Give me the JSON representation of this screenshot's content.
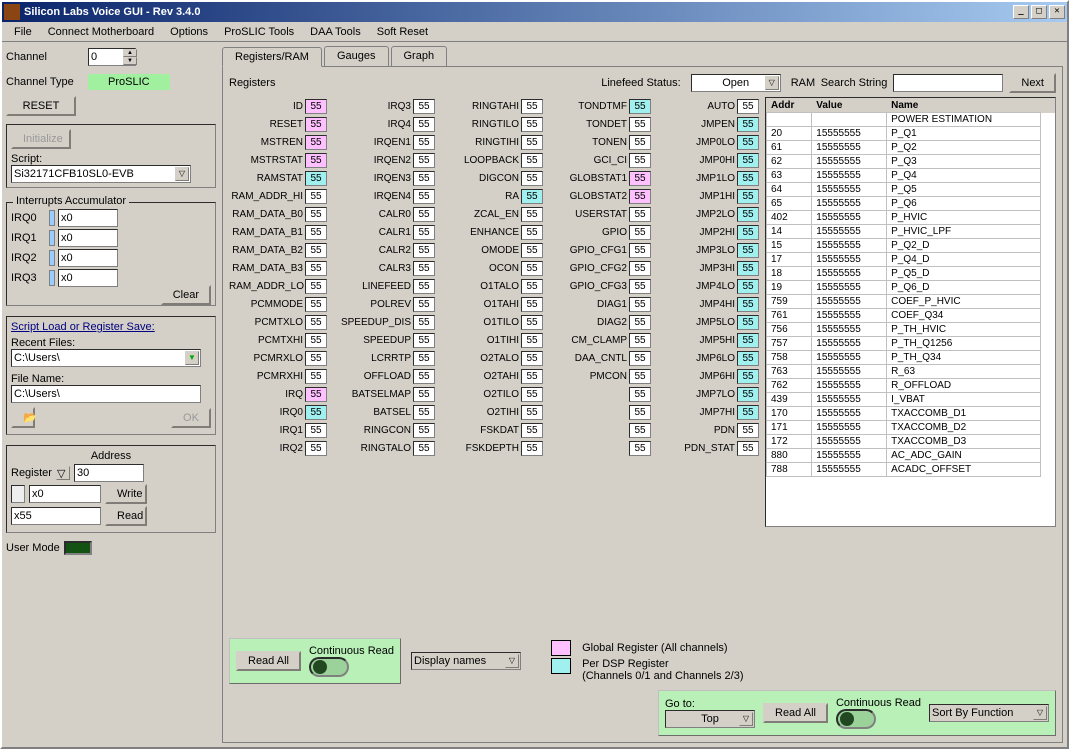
{
  "title": "Silicon Labs Voice GUI - Rev 3.4.0",
  "menu": [
    "File",
    "Connect Motherboard",
    "Options",
    "ProSLIC Tools",
    "DAA Tools",
    "Soft Reset"
  ],
  "left": {
    "channel_lbl": "Channel",
    "channel_val": "0",
    "chtype_lbl": "Channel Type",
    "chtype_val": "ProSLIC",
    "reset": "RESET",
    "init": "Initialize",
    "script_lbl": "Script:",
    "script_val": "Si32171CFB10SL0-EVB",
    "int_title": "Interrupts Accumulator",
    "irqs": [
      {
        "lbl": "IRQ0",
        "val": "x0"
      },
      {
        "lbl": "IRQ1",
        "val": "x0"
      },
      {
        "lbl": "IRQ2",
        "val": "x0"
      },
      {
        "lbl": "IRQ3",
        "val": "x0"
      }
    ],
    "clear": "Clear",
    "sls_title": "Script Load or Register Save:",
    "recent_lbl": "Recent Files:",
    "recent_val": "C:\\Users\\",
    "fname_lbl": "File Name:",
    "fname_val": "C:\\Users\\",
    "ok": "OK",
    "addr_title": "Address",
    "reg_lbl": "Register",
    "reg_val": "30",
    "write_val": "x0",
    "write": "Write",
    "read_val": "x55",
    "read": "Read",
    "usermode": "User Mode"
  },
  "tabs": [
    "Registers/RAM",
    "Gauges",
    "Graph"
  ],
  "reg_hdr": "Registers",
  "linefeed_lbl": "Linefeed Status:",
  "linefeed_val": "Open",
  "ram_lbl": "RAM",
  "search_lbl": "Search String",
  "next": "Next",
  "registers": [
    [
      {
        "n": "ID",
        "v": "55",
        "c": "pink"
      },
      {
        "n": "RESET",
        "v": "55",
        "c": "pink"
      },
      {
        "n": "MSTREN",
        "v": "55",
        "c": "pink"
      },
      {
        "n": "MSTRSTAT",
        "v": "55",
        "c": "pink"
      },
      {
        "n": "RAMSTAT",
        "v": "55",
        "c": "cyan"
      },
      {
        "n": "RAM_ADDR_HI",
        "v": "55"
      },
      {
        "n": "RAM_DATA_B0",
        "v": "55"
      },
      {
        "n": "RAM_DATA_B1",
        "v": "55"
      },
      {
        "n": "RAM_DATA_B2",
        "v": "55"
      },
      {
        "n": "RAM_DATA_B3",
        "v": "55"
      },
      {
        "n": "RAM_ADDR_LO",
        "v": "55"
      },
      {
        "n": "PCMMODE",
        "v": "55"
      },
      {
        "n": "PCMTXLO",
        "v": "55"
      },
      {
        "n": "PCMTXHI",
        "v": "55"
      },
      {
        "n": "PCMRXLO",
        "v": "55"
      },
      {
        "n": "PCMRXHI",
        "v": "55"
      },
      {
        "n": "IRQ",
        "v": "55",
        "c": "pink"
      },
      {
        "n": "IRQ0",
        "v": "55",
        "c": "cyan"
      },
      {
        "n": "IRQ1",
        "v": "55"
      },
      {
        "n": "IRQ2",
        "v": "55"
      }
    ],
    [
      {
        "n": "IRQ3",
        "v": "55"
      },
      {
        "n": "IRQ4",
        "v": "55"
      },
      {
        "n": "IRQEN1",
        "v": "55"
      },
      {
        "n": "IRQEN2",
        "v": "55"
      },
      {
        "n": "IRQEN3",
        "v": "55"
      },
      {
        "n": "IRQEN4",
        "v": "55"
      },
      {
        "n": "CALR0",
        "v": "55"
      },
      {
        "n": "CALR1",
        "v": "55"
      },
      {
        "n": "CALR2",
        "v": "55"
      },
      {
        "n": "CALR3",
        "v": "55"
      },
      {
        "n": "LINEFEED",
        "v": "55"
      },
      {
        "n": "POLREV",
        "v": "55"
      },
      {
        "n": "SPEEDUP_DIS",
        "v": "55"
      },
      {
        "n": "SPEEDUP",
        "v": "55"
      },
      {
        "n": "LCRRTP",
        "v": "55"
      },
      {
        "n": "OFFLOAD",
        "v": "55"
      },
      {
        "n": "BATSELMAP",
        "v": "55"
      },
      {
        "n": "BATSEL",
        "v": "55"
      },
      {
        "n": "RINGCON",
        "v": "55"
      },
      {
        "n": "RINGTALO",
        "v": "55"
      }
    ],
    [
      {
        "n": "RINGTAHI",
        "v": "55"
      },
      {
        "n": "RINGTILO",
        "v": "55"
      },
      {
        "n": "RINGTIHI",
        "v": "55"
      },
      {
        "n": "LOOPBACK",
        "v": "55"
      },
      {
        "n": "DIGCON",
        "v": "55"
      },
      {
        "n": "RA",
        "v": "55",
        "c": "cyan"
      },
      {
        "n": "ZCAL_EN",
        "v": "55"
      },
      {
        "n": "ENHANCE",
        "v": "55"
      },
      {
        "n": "OMODE",
        "v": "55"
      },
      {
        "n": "OCON",
        "v": "55"
      },
      {
        "n": "O1TALO",
        "v": "55"
      },
      {
        "n": "O1TAHI",
        "v": "55"
      },
      {
        "n": "O1TILO",
        "v": "55"
      },
      {
        "n": "O1TIHI",
        "v": "55"
      },
      {
        "n": "O2TALO",
        "v": "55"
      },
      {
        "n": "O2TAHI",
        "v": "55"
      },
      {
        "n": "O2TILO",
        "v": "55"
      },
      {
        "n": "O2TIHI",
        "v": "55"
      },
      {
        "n": "FSKDAT",
        "v": "55"
      },
      {
        "n": "FSKDEPTH",
        "v": "55"
      }
    ],
    [
      {
        "n": "TONDTMF",
        "v": "55",
        "c": "cyan"
      },
      {
        "n": "TONDET",
        "v": "55"
      },
      {
        "n": "TONEN",
        "v": "55"
      },
      {
        "n": "GCI_CI",
        "v": "55"
      },
      {
        "n": "GLOBSTAT1",
        "v": "55",
        "c": "pink"
      },
      {
        "n": "GLOBSTAT2",
        "v": "55",
        "c": "pink"
      },
      {
        "n": "USERSTAT",
        "v": "55"
      },
      {
        "n": "GPIO",
        "v": "55"
      },
      {
        "n": "GPIO_CFG1",
        "v": "55"
      },
      {
        "n": "GPIO_CFG2",
        "v": "55"
      },
      {
        "n": "GPIO_CFG3",
        "v": "55"
      },
      {
        "n": "DIAG1",
        "v": "55"
      },
      {
        "n": "DIAG2",
        "v": "55"
      },
      {
        "n": "CM_CLAMP",
        "v": "55"
      },
      {
        "n": "DAA_CNTL",
        "v": "55"
      },
      {
        "n": "PMCON",
        "v": "55"
      },
      {
        "n": "",
        "v": "55"
      },
      {
        "n": "",
        "v": "55"
      },
      {
        "n": "",
        "v": "55"
      },
      {
        "n": "",
        "v": "55"
      }
    ],
    [
      {
        "n": "AUTO",
        "v": "55"
      },
      {
        "n": "JMPEN",
        "v": "55",
        "c": "cyan"
      },
      {
        "n": "JMP0LO",
        "v": "55",
        "c": "cyan"
      },
      {
        "n": "JMP0HI",
        "v": "55",
        "c": "cyan"
      },
      {
        "n": "JMP1LO",
        "v": "55",
        "c": "cyan"
      },
      {
        "n": "JMP1HI",
        "v": "55",
        "c": "cyan"
      },
      {
        "n": "JMP2LO",
        "v": "55",
        "c": "cyan"
      },
      {
        "n": "JMP2HI",
        "v": "55",
        "c": "cyan"
      },
      {
        "n": "JMP3LO",
        "v": "55",
        "c": "cyan"
      },
      {
        "n": "JMP3HI",
        "v": "55",
        "c": "cyan"
      },
      {
        "n": "JMP4LO",
        "v": "55",
        "c": "cyan"
      },
      {
        "n": "JMP4HI",
        "v": "55",
        "c": "cyan"
      },
      {
        "n": "JMP5LO",
        "v": "55",
        "c": "cyan"
      },
      {
        "n": "JMP5HI",
        "v": "55",
        "c": "cyan"
      },
      {
        "n": "JMP6LO",
        "v": "55",
        "c": "cyan"
      },
      {
        "n": "JMP6HI",
        "v": "55",
        "c": "cyan"
      },
      {
        "n": "JMP7LO",
        "v": "55",
        "c": "cyan"
      },
      {
        "n": "JMP7HI",
        "v": "55",
        "c": "cyan"
      },
      {
        "n": "PDN",
        "v": "55"
      },
      {
        "n": "PDN_STAT",
        "v": "55"
      }
    ]
  ],
  "ram_cols": [
    "Addr",
    "Value",
    "Name"
  ],
  "ram_rows": [
    {
      "a": "",
      "v": "",
      "n": "POWER ESTIMATION"
    },
    {
      "a": "20",
      "v": "15555555",
      "n": "P_Q1"
    },
    {
      "a": "61",
      "v": "15555555",
      "n": "P_Q2"
    },
    {
      "a": "62",
      "v": "15555555",
      "n": "P_Q3"
    },
    {
      "a": "63",
      "v": "15555555",
      "n": "P_Q4"
    },
    {
      "a": "64",
      "v": "15555555",
      "n": "P_Q5"
    },
    {
      "a": "65",
      "v": "15555555",
      "n": "P_Q6"
    },
    {
      "a": "402",
      "v": "15555555",
      "n": "P_HVIC"
    },
    {
      "a": "14",
      "v": "15555555",
      "n": "P_HVIC_LPF"
    },
    {
      "a": "15",
      "v": "15555555",
      "n": "P_Q2_D"
    },
    {
      "a": "17",
      "v": "15555555",
      "n": "P_Q4_D"
    },
    {
      "a": "18",
      "v": "15555555",
      "n": "P_Q5_D"
    },
    {
      "a": "19",
      "v": "15555555",
      "n": "P_Q6_D"
    },
    {
      "a": "759",
      "v": "15555555",
      "n": "COEF_P_HVIC"
    },
    {
      "a": "761",
      "v": "15555555",
      "n": "COEF_Q34"
    },
    {
      "a": "756",
      "v": "15555555",
      "n": "P_TH_HVIC"
    },
    {
      "a": "757",
      "v": "15555555",
      "n": "P_TH_Q1256"
    },
    {
      "a": "758",
      "v": "15555555",
      "n": "P_TH_Q34"
    },
    {
      "a": "763",
      "v": "15555555",
      "n": "R_63"
    },
    {
      "a": "762",
      "v": "15555555",
      "n": "R_OFFLOAD"
    },
    {
      "a": "439",
      "v": "15555555",
      "n": "I_VBAT"
    },
    {
      "a": "170",
      "v": "15555555",
      "n": "TXACCOMB_D1"
    },
    {
      "a": "171",
      "v": "15555555",
      "n": "TXACCOMB_D2"
    },
    {
      "a": "172",
      "v": "15555555",
      "n": "TXACCOMB_D3"
    },
    {
      "a": "880",
      "v": "15555555",
      "n": "AC_ADC_GAIN"
    },
    {
      "a": "788",
      "v": "15555555",
      "n": "ACADC_OFFSET"
    }
  ],
  "footer": {
    "cont_read": "Continuous Read",
    "read_all": "Read All",
    "display": "Display names",
    "legend1": "Global Register (All channels)",
    "legend2": "Per DSP Register\n(Channels 0/1 and Channels 2/3)",
    "goto": "Go to:",
    "top": "Top",
    "sort": "Sort By Function"
  }
}
